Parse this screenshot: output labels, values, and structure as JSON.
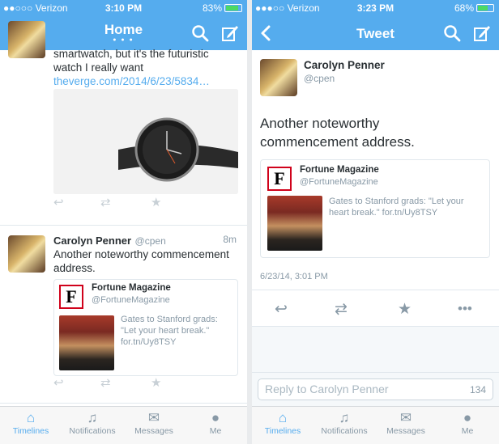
{
  "left": {
    "status": {
      "carrier": "●●○○○ Verizon",
      "time": "3:10 PM",
      "battery": "83%",
      "battery_level": 0.83
    },
    "nav": {
      "title": "Home",
      "dots": "● ● ●"
    },
    "prev_tweet": {
      "text_1": "smartwatch, but it's the futuristic",
      "text_2": "watch I really want",
      "link": "theverge.com/2014/6/23/5834…"
    },
    "tweet": {
      "name": "Carolyn Penner",
      "handle": "@cpen",
      "time": "8m",
      "text": "Another noteworthy commencement address.",
      "card": {
        "logo": "F",
        "name": "Fortune Magazine",
        "handle": "@FortuneMagazine",
        "text": "Gates to Stanford grads: \"Let your heart break.\" for.tn/Uy8TSY"
      }
    },
    "tabs": [
      {
        "label": "Timelines",
        "icon": "home-icon"
      },
      {
        "label": "Notifications",
        "icon": "bell-icon"
      },
      {
        "label": "Messages",
        "icon": "envelope-icon"
      },
      {
        "label": "Me",
        "icon": "person-icon"
      }
    ]
  },
  "right": {
    "status": {
      "carrier": "●●●○○ Verizon",
      "time": "3:23 PM",
      "battery": "68%",
      "battery_level": 0.68
    },
    "nav": {
      "title": "Tweet"
    },
    "tweet": {
      "name": "Carolyn Penner",
      "handle": "@cpen",
      "text": "Another noteworthy commencement address.",
      "card": {
        "logo": "F",
        "name": "Fortune Magazine",
        "handle": "@FortuneMagazine",
        "text": "Gates to Stanford grads: \"Let your heart break.\" for.tn/Uy8TSY"
      },
      "timestamp": "6/23/14, 3:01 PM"
    },
    "reply": {
      "placeholder": "Reply to Carolyn Penner",
      "count": "134"
    },
    "tabs": [
      {
        "label": "Timelines",
        "icon": "home-icon"
      },
      {
        "label": "Notifications",
        "icon": "bell-icon"
      },
      {
        "label": "Messages",
        "icon": "envelope-icon"
      },
      {
        "label": "Me",
        "icon": "person-icon"
      }
    ]
  },
  "colors": {
    "accent": "#55acee",
    "text": "#292f33",
    "muted": "#8899a6"
  }
}
